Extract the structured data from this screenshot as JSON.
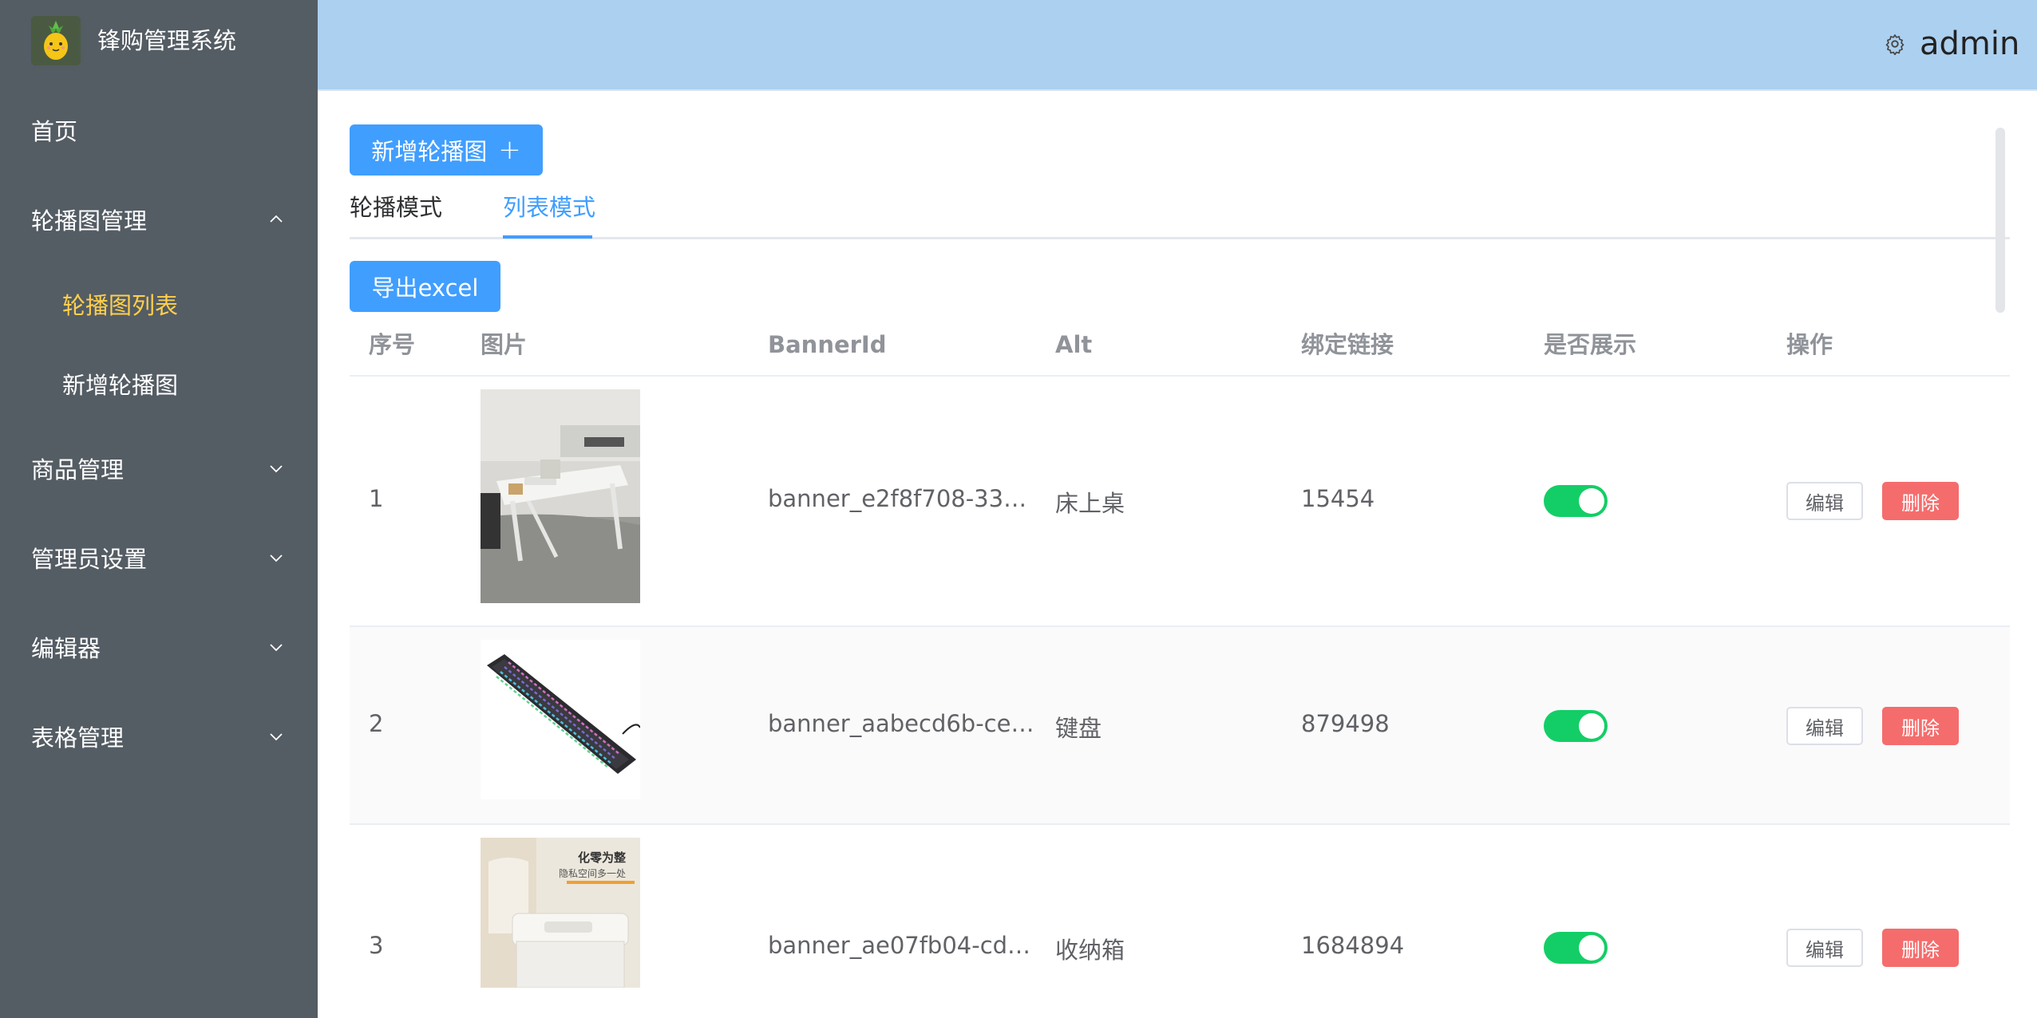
{
  "app": {
    "title": "锋购管理系统",
    "user": "admin",
    "colors": {
      "sidebar_bg": "#545c64",
      "header_bg": "#acd0ef",
      "primary": "#409eff",
      "active_menu": "#ffd04b",
      "switch_on": "#13ce66",
      "danger": "#f56c6c"
    }
  },
  "sidebar": {
    "home": "首页",
    "banner_mgmt": "轮播图管理",
    "banner_list": "轮播图列表",
    "banner_add": "新增轮播图",
    "goods_mgmt": "商品管理",
    "admin_settings": "管理员设置",
    "editor": "编辑器",
    "table_mgmt": "表格管理"
  },
  "toolbar": {
    "add_label": "新增轮播图",
    "add_icon": "plus-icon",
    "export_label": "导出excel"
  },
  "tabs": {
    "carousel_mode": "轮播模式",
    "list_mode": "列表模式",
    "active": "列表模式"
  },
  "table": {
    "headers": {
      "index": "序号",
      "image": "图片",
      "banner_id": "BannerId",
      "alt": "Alt",
      "link": "绑定链接",
      "show": "是否展示",
      "actions": "操作"
    },
    "rows": [
      {
        "index": "1",
        "image": "bed-desk-photo",
        "banner_id": "banner_e2f8f708-33…",
        "alt": "床上桌",
        "link": "15454",
        "show": true,
        "edit": "编辑",
        "delete": "删除"
      },
      {
        "index": "2",
        "image": "keyboard-photo",
        "banner_id": "banner_aabecd6b-ce…",
        "alt": "键盘",
        "link": "879498",
        "show": true,
        "edit": "编辑",
        "delete": "删除"
      },
      {
        "index": "3",
        "image": "storage-box-photo",
        "banner_id": "banner_ae07fb04-cd…",
        "alt": "收纳箱",
        "link": "1684894",
        "show": true,
        "edit": "编辑",
        "delete": "删除"
      }
    ],
    "storage_box_caption": {
      "line1": "化零为整",
      "line2": "隐私空间多一处"
    }
  }
}
